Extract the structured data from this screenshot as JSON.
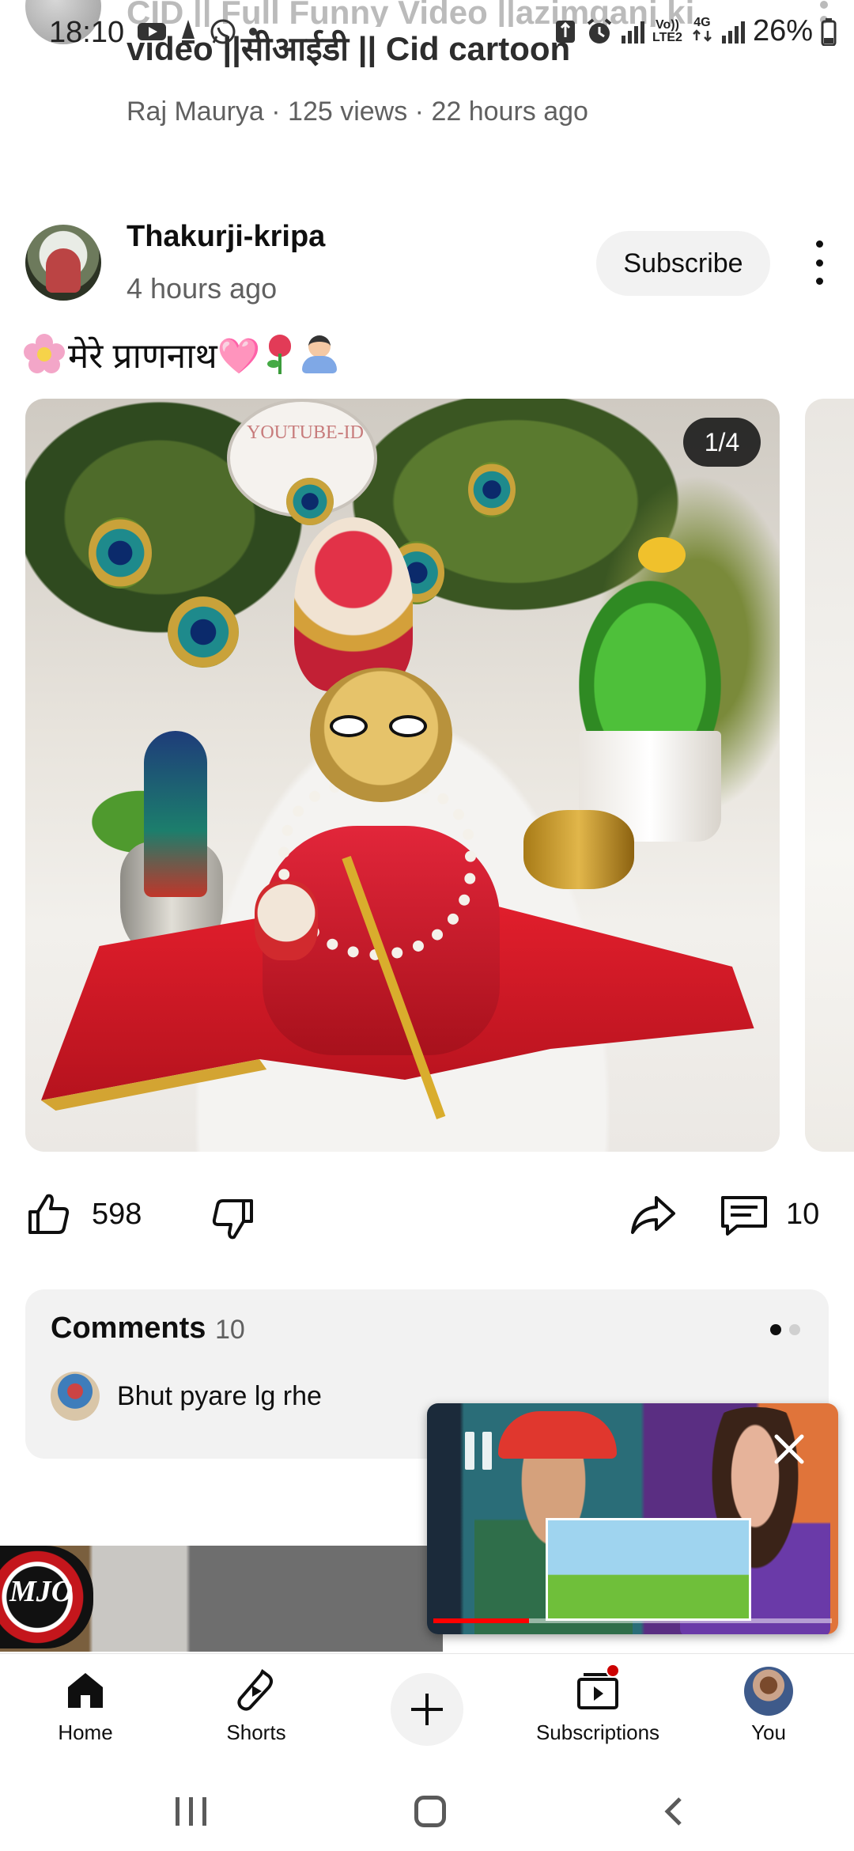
{
  "status_bar": {
    "time": "18:10",
    "network_top": "Vo))",
    "network_bottom": "LTE2",
    "network_type": "4G",
    "battery": "26%",
    "icons": [
      "youtube-icon",
      "location-icon",
      "whatsapp-icon",
      "dot-icon",
      "nfc-icon",
      "alarm-icon",
      "signal-icon",
      "battery-icon"
    ]
  },
  "previous_video": {
    "title_line1": "CID || Full Funny Video ||azimganj ki",
    "title_line2": "video ||सीआईडी || Cid cartoon",
    "meta": "Raj Maurya · 125 views · 22 hours ago"
  },
  "post": {
    "channel": "Thakurji-kripa",
    "time": "4 hours ago",
    "subscribe_label": "Subscribe",
    "text": "मेरे प्राणनाथ🩷",
    "counter": "1/4",
    "likes": "598",
    "comments_count": "10"
  },
  "comments_card": {
    "title": "Comments",
    "count": "10",
    "top_comment": "Bhut pyare lg rhe"
  },
  "feed": {
    "logo_text": "MJO"
  },
  "mini_player": {
    "progress": 0.24
  },
  "bottom_nav": {
    "home": "Home",
    "shorts": "Shorts",
    "subscriptions": "Subscriptions",
    "you": "You"
  },
  "colors": {
    "accent": "#ff0000",
    "text_primary": "#0f0f0f",
    "text_secondary": "#606060",
    "chip_bg": "#f2f2f2"
  }
}
